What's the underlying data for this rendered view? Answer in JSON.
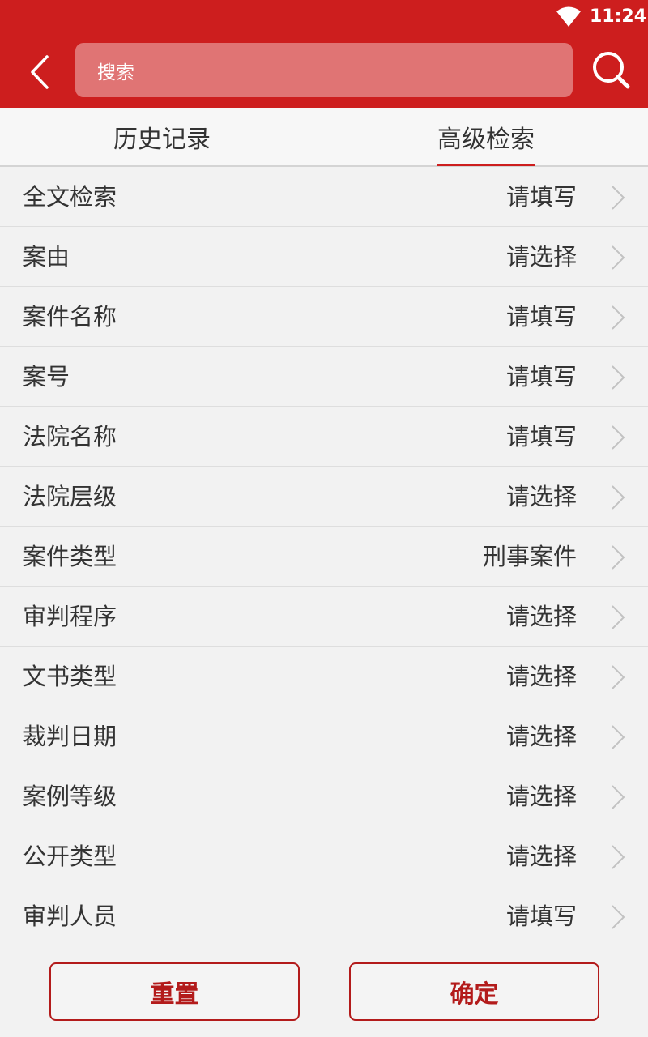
{
  "status_bar": {
    "time": "11:24"
  },
  "header": {
    "search_placeholder": "搜索"
  },
  "tabs": [
    {
      "label": "历史记录",
      "active": false
    },
    {
      "label": "高级检索",
      "active": true
    }
  ],
  "fields": [
    {
      "label": "全文检索",
      "value": "请填写"
    },
    {
      "label": "案由",
      "value": "请选择"
    },
    {
      "label": "案件名称",
      "value": "请填写"
    },
    {
      "label": "案号",
      "value": "请填写"
    },
    {
      "label": "法院名称",
      "value": "请填写"
    },
    {
      "label": "法院层级",
      "value": "请选择"
    },
    {
      "label": "案件类型",
      "value": "刑事案件"
    },
    {
      "label": "审判程序",
      "value": "请选择"
    },
    {
      "label": "文书类型",
      "value": "请选择"
    },
    {
      "label": "裁判日期",
      "value": "请选择"
    },
    {
      "label": "案例等级",
      "value": "请选择"
    },
    {
      "label": "公开类型",
      "value": "请选择"
    },
    {
      "label": "审判人员",
      "value": "请填写"
    }
  ],
  "footer": {
    "reset_label": "重置",
    "confirm_label": "确定"
  },
  "colors": {
    "header_red": "#cd1e1e",
    "button_red": "#b31b1b"
  }
}
